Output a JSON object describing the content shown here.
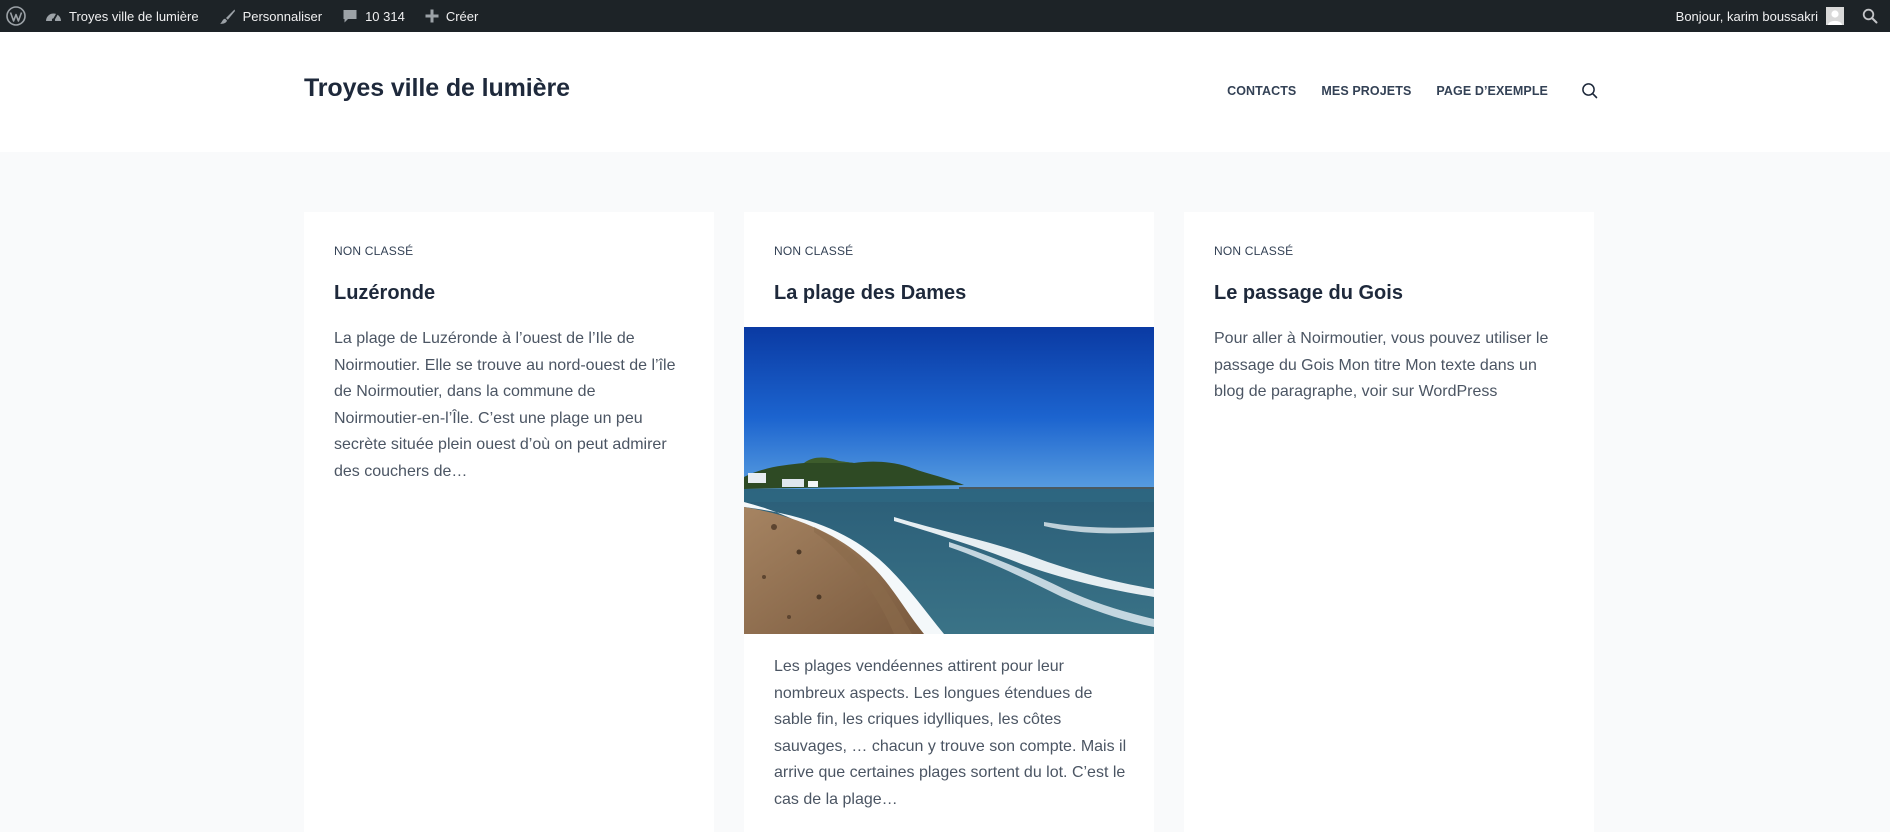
{
  "adminbar": {
    "site_name": "Troyes ville de lumière",
    "customize": "Personnaliser",
    "comments_count": "10 314",
    "new": "Créer",
    "greeting": "Bonjour, karim boussakri"
  },
  "header": {
    "site_title": "Troyes ville de lumière",
    "nav": [
      "CONTACTS",
      "MES PROJETS",
      "PAGE D’EXEMPLE"
    ]
  },
  "posts": [
    {
      "category": "NON CLASSÉ",
      "title": "Luzéronde",
      "excerpt": "La plage de Luzéronde à l’ouest de l’Ile de Noirmoutier. Elle se trouve au nord-ouest de l’île de Noirmoutier, dans la commune de Noirmoutier-en-l’Île. C’est une plage un peu secrète située plein ouest d’où on peut admirer des couchers de…"
    },
    {
      "category": "NON CLASSÉ",
      "title": "La plage des Dames",
      "excerpt": "Les plages vendéennes attirent pour leur nombreux aspects. Les longues étendues de sable fin, les criques idylliques, les côtes sauvages, … chacun y trouve son compte. Mais il arrive que certaines plages sortent du lot. C’est le cas de la plage…"
    },
    {
      "category": "NON CLASSÉ",
      "title": "Le passage du Gois",
      "excerpt": "Pour aller à Noirmoutier, vous pouvez utiliser le passage du Gois Mon titre Mon texte dans un blog de paragraphe, voir sur WordPress"
    }
  ],
  "colors": {
    "adminbar_bg": "#1d2327",
    "page_bg": "#f9fafb",
    "title_text": "#1e293b",
    "body_text": "#4b5563"
  }
}
